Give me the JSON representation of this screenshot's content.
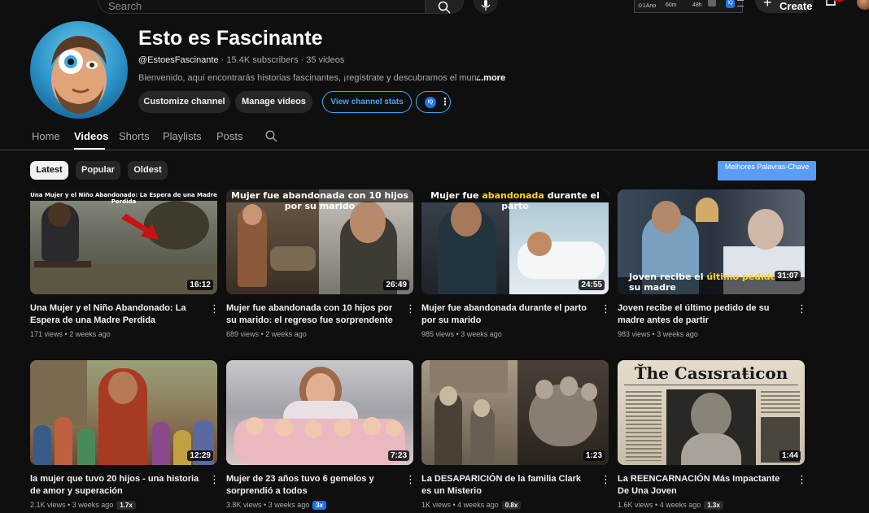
{
  "topbar": {
    "search_placeholder": "Search",
    "ext_stat1": "⊙1Ano",
    "ext_stat2": "60m",
    "ext_stat3": "48h",
    "ext_iq": "IQ",
    "create_label": "Create"
  },
  "channel": {
    "name": "Esto es Fascinante",
    "handle": "@EstoesFascinante",
    "subscribers": "15.4K subscribers",
    "video_count": "35 videos",
    "description": "Bienvenido, aquí encontrarás historias fascinantes, ¡regístrate y descubramos el mundo ju",
    "more_label": "...more",
    "buttons": {
      "customize": "Customize channel",
      "manage": "Manage videos",
      "stats": "View channel stats",
      "iq": "IQ",
      "iq_more": "⋮"
    }
  },
  "tabs": [
    "Home",
    "Videos",
    "Shorts",
    "Playlists",
    "Posts"
  ],
  "active_tab": "Videos",
  "filters": [
    "Latest",
    "Popular",
    "Oldest"
  ],
  "active_filter": "Latest",
  "keyword_button": "Melhores Palavras-Chave",
  "videos": [
    {
      "title": "Una Mujer y el Niño Abandonado: La Espera de una Madre Perdida",
      "views": "171 views",
      "age": "2 weeks ago",
      "duration": "16:12",
      "thumb_caption": "Una Mujer y el Niño Abandonado: La Espera de una Madre Perdida",
      "badge": ""
    },
    {
      "title": "Mujer fue abandonada con 10 hijos por su marido: el regreso fue sorprendente",
      "views": "689 views",
      "age": "2 weeks ago",
      "duration": "26:49",
      "thumb_caption": "Mujer fue abandonada con 10 hijos por su marido",
      "badge": ""
    },
    {
      "title": "Mujer fue abandonada durante el parto por su marido",
      "views": "985 views",
      "age": "3 weeks ago",
      "duration": "24:55",
      "thumb_caption_a": "Mujer fue ",
      "thumb_caption_hl": "abandonada",
      "thumb_caption_b": " durante el parto",
      "badge": ""
    },
    {
      "title": "Joven recibe el último pedido de su madre antes de partir",
      "views": "983 views",
      "age": "3 weeks ago",
      "duration": "31:07",
      "thumb_caption_a": "Joven recibe el ",
      "thumb_caption_hl": "último pedido",
      "thumb_caption_b": " de su madre",
      "badge": ""
    },
    {
      "title": "la mujer que tuvo 20 hijos - una historia de amor y superación",
      "views": "2.1K views",
      "age": "3 weeks ago",
      "duration": "12:29",
      "badge": "1.7x"
    },
    {
      "title": "Mujer de 23 años tuvo 6 gemelos y sorprendió a todos",
      "views": "3.8K views",
      "age": "3 weeks ago",
      "duration": "7:23",
      "badge": "3x"
    },
    {
      "title": "La DESAPARICIÓN de la familia Clark es un Misterio",
      "views": "1K views",
      "age": "4 weeks ago",
      "duration": "1:23",
      "badge": "0.8x"
    },
    {
      "title": "La REENCARNACIÓN Más Impactante De Una Joven",
      "views": "1.6K views",
      "age": "4 weeks ago",
      "duration": "1:44",
      "thumb_caption": "Ťhe Casɪsraŧicon",
      "badge": "1.3x"
    }
  ],
  "colors": {
    "background": "#0f0f0f",
    "accent_blue": "#3ea6ff",
    "keyword_blue": "#5b9cf6",
    "caption_yellow": "#ffd21f"
  }
}
